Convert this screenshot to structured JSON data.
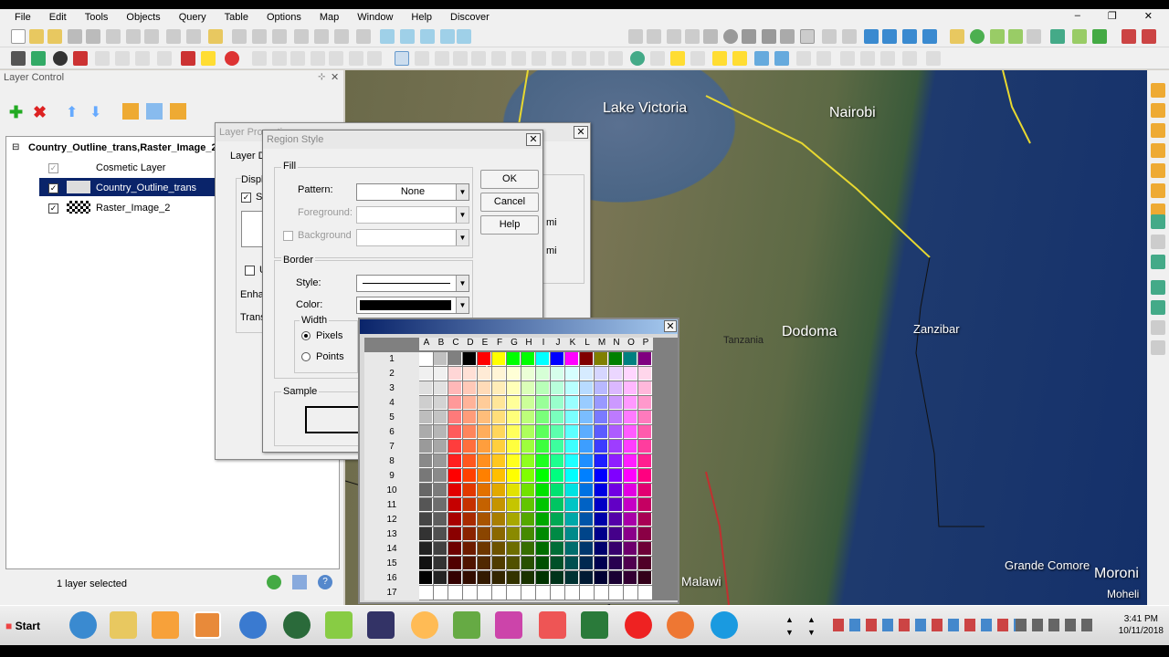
{
  "menu": [
    "File",
    "Edit",
    "Tools",
    "Objects",
    "Query",
    "Table",
    "Options",
    "Map",
    "Window",
    "Help",
    "Discover"
  ],
  "layer_control": {
    "title": "Layer Control",
    "root": "Country_Outline_trans,Raster_Image_2",
    "layers": [
      {
        "name": "Cosmetic Layer",
        "checked": true,
        "selected": false
      },
      {
        "name": "Country_Outline_trans",
        "checked": true,
        "selected": true
      },
      {
        "name": "Raster_Image_2",
        "checked": true,
        "selected": false
      }
    ],
    "status": "1 layer selected"
  },
  "layer_properties": {
    "title": "Layer Properties",
    "layer_d": "Layer D",
    "display": "Displ",
    "s": "S",
    "u": "U",
    "enh": "Enha",
    "trans": "Trans",
    "mi1": "mi",
    "mi2": "mi"
  },
  "region_style": {
    "title": "Region Style",
    "fill_label": "Fill",
    "pattern_label": "Pattern:",
    "pattern_value": "None",
    "foreground_label": "Foreground:",
    "background_label": "Background",
    "border_label": "Border",
    "style_label": "Style:",
    "color_label": "Color:",
    "width_label": "Width",
    "pixels_label": "Pixels",
    "points_label": "Points",
    "sample_label": "Sample",
    "ok": "OK",
    "cancel": "Cancel",
    "help": "Help"
  },
  "palette": {
    "columns": [
      "A",
      "B",
      "C",
      "D",
      "E",
      "F",
      "G",
      "H",
      "I",
      "J",
      "K",
      "L",
      "M",
      "N",
      "O",
      "P"
    ],
    "rows": [
      "1",
      "2",
      "3",
      "4",
      "5",
      "6",
      "7",
      "8",
      "9",
      "10",
      "11",
      "12",
      "13",
      "14",
      "15",
      "16",
      "17"
    ],
    "row1": [
      "#ffffff",
      "#c0c0c0",
      "#808080",
      "#000000",
      "#ff0000",
      "#ffff00",
      "#00ff00",
      "#00ff00",
      "#00ffff",
      "#0000ff",
      "#ff00ff",
      "#800000",
      "#808000",
      "#008000",
      "#008080",
      "#800080"
    ]
  },
  "map": {
    "labels": [
      "Lake Victoria",
      "Nairobi",
      "Tanzania",
      "Dodoma",
      "Zanzibar",
      "Grande Comore",
      "Moroni",
      "Moheli",
      "Malawi"
    ]
  },
  "taskbar": {
    "start": "Start",
    "time": "3:41 PM",
    "date": "10/11/2018"
  }
}
